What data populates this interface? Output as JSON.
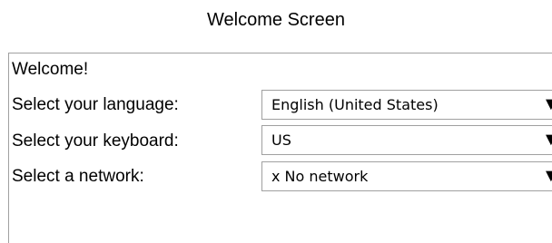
{
  "window": {
    "title": "Welcome Screen"
  },
  "panel": {
    "welcome": "Welcome!",
    "rows": [
      {
        "label": "Select your language:",
        "value": "English (United States)",
        "arrow": "▼",
        "icon": "triangle-down-icon"
      },
      {
        "label": "Select your keyboard:",
        "value": "US",
        "arrow": "▼",
        "icon": "triangle-down-icon"
      },
      {
        "label": "Select a network:",
        "value": "x No network",
        "arrow": "▼",
        "icon": "triangle-down-icon"
      }
    ]
  },
  "colors": {
    "border": "#a0a0a0",
    "background": "#ffffff",
    "text": "#000000"
  }
}
